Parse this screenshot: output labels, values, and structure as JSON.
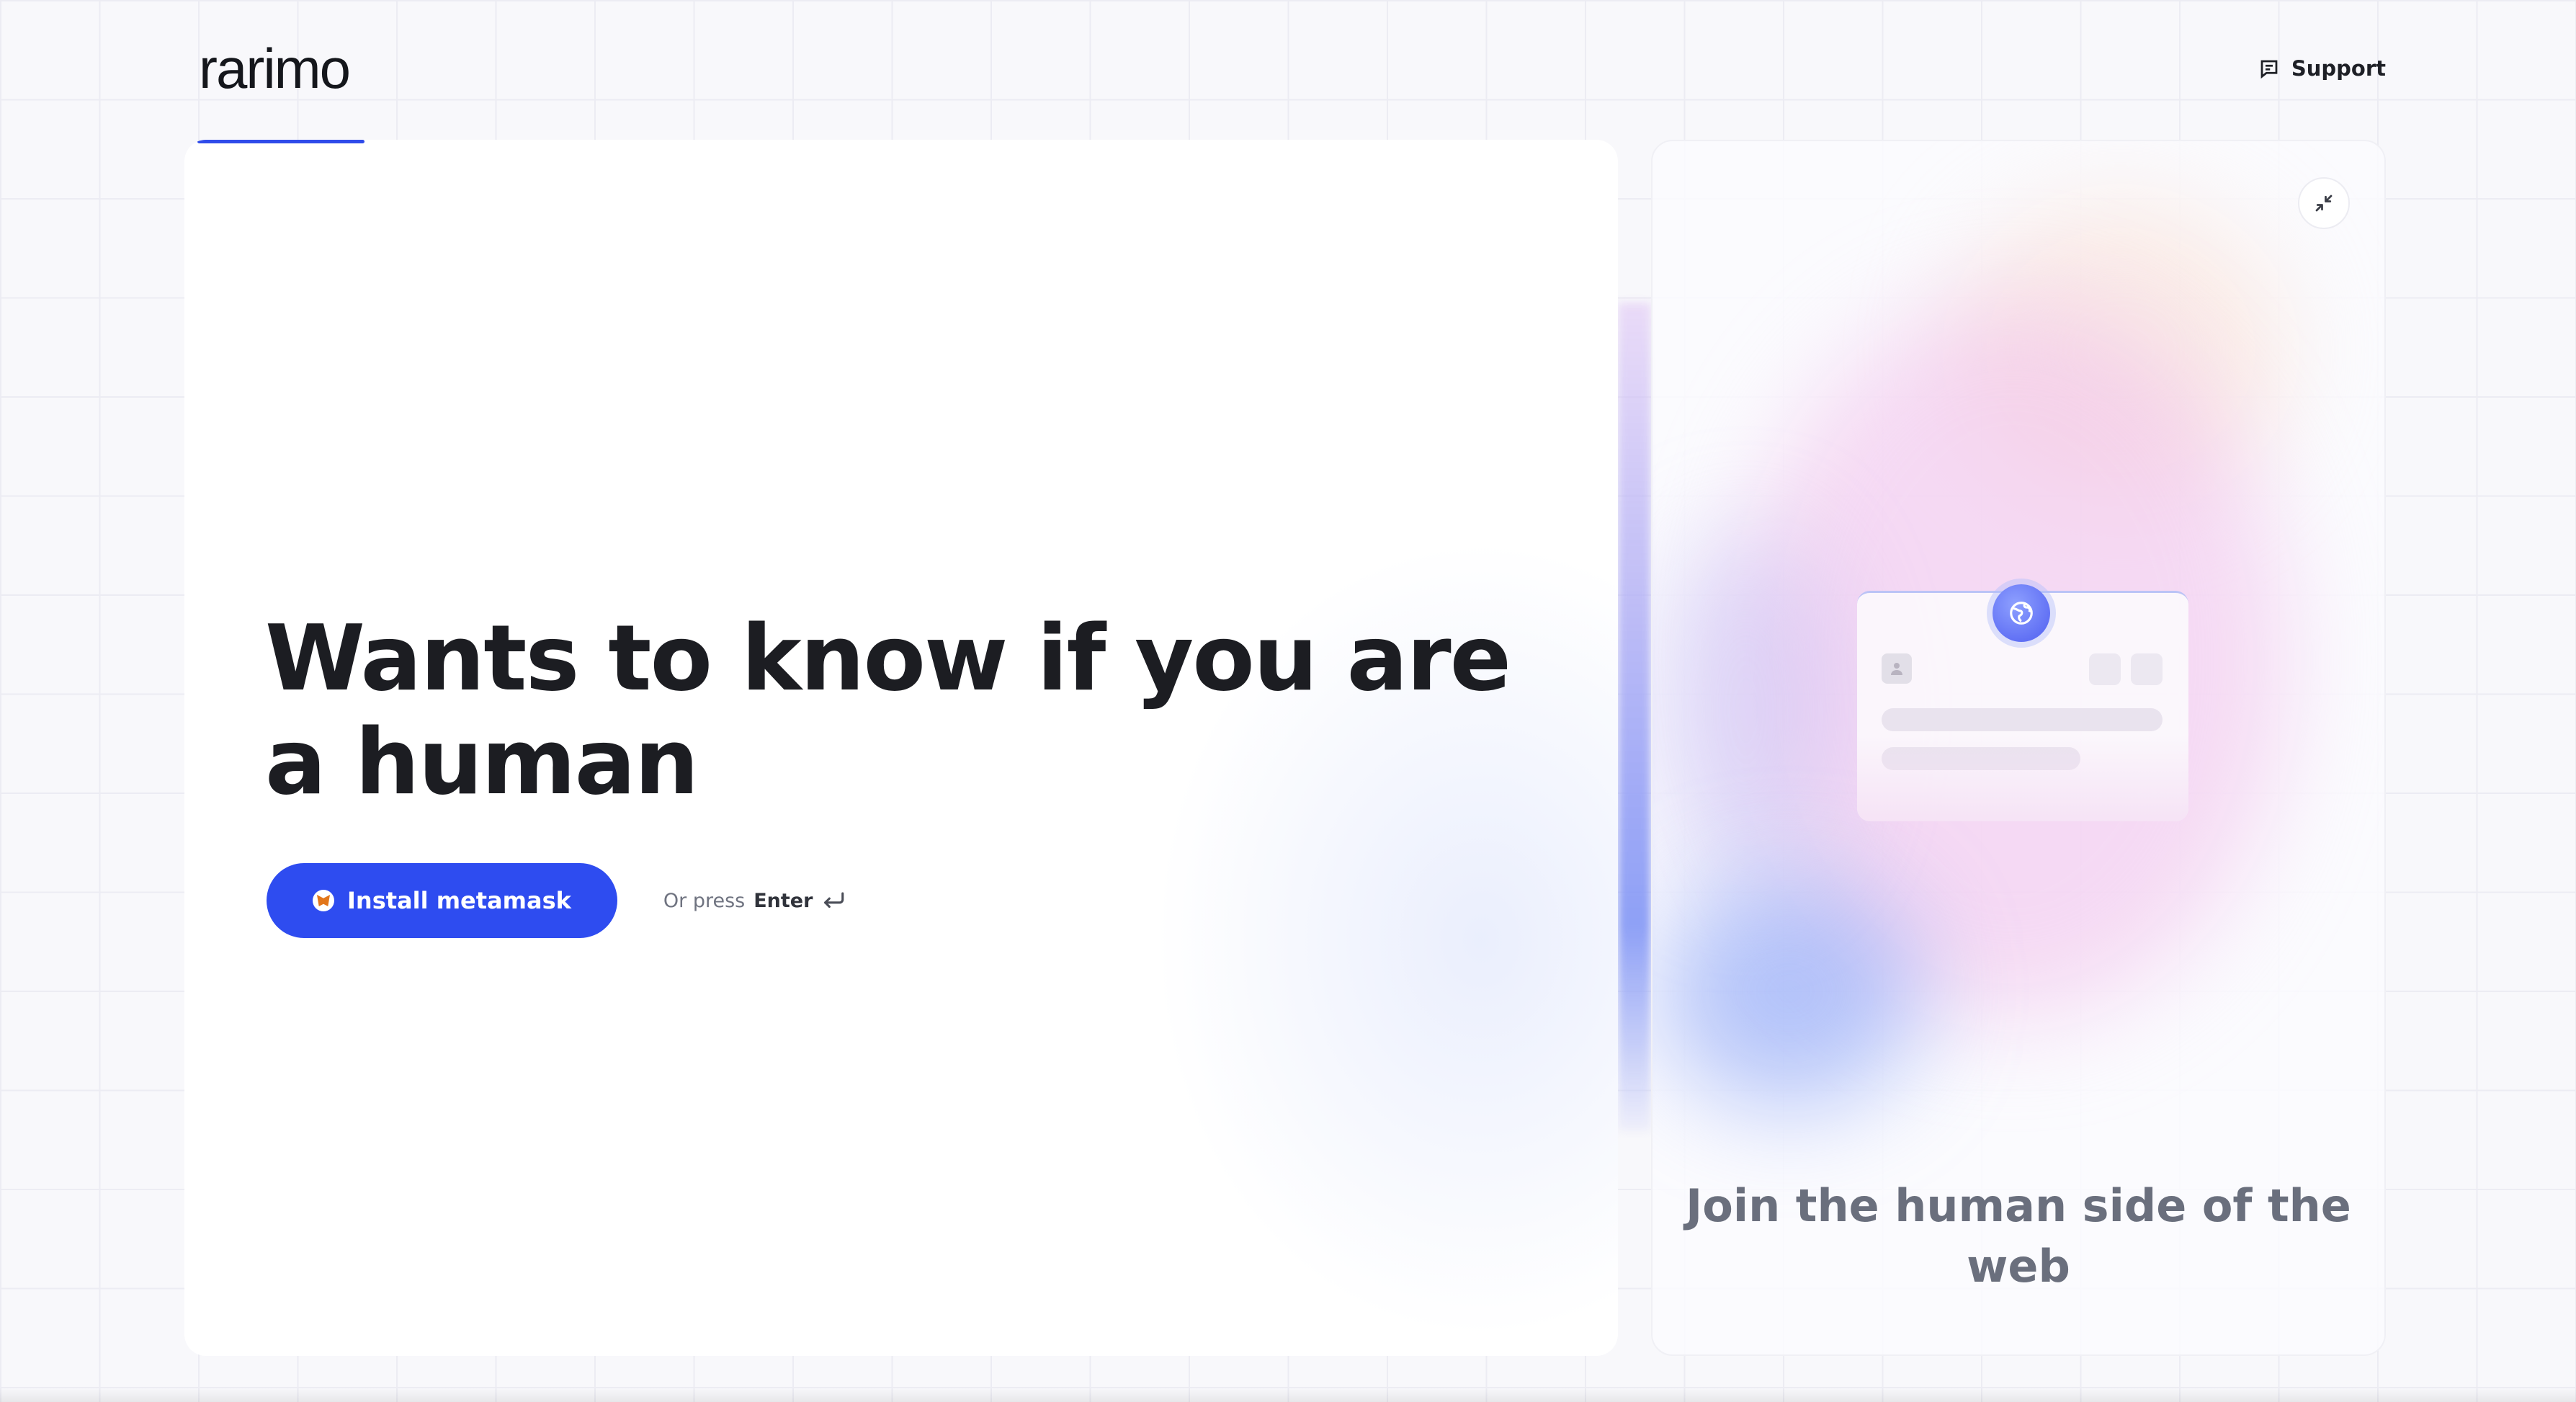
{
  "header": {
    "logo_text": "rarimo",
    "support_label": "Support",
    "support_icon": "chat-bubble-icon"
  },
  "main": {
    "headline": "Wants to know if you are a human",
    "install_button_label": "Install metamask",
    "install_button_icon": "metamask-fox-icon",
    "press_hint_prefix": "Or press",
    "press_hint_key": "Enter",
    "press_hint_icon": "enter-return-icon"
  },
  "side_panel": {
    "collapse_icon": "collapse-arrows-icon",
    "badge_icon": "globe-icon",
    "avatar_icon": "user-icon",
    "caption": "Join the human side of the web"
  },
  "colors": {
    "accent": "#2e4cf0",
    "headline": "#1c1d22",
    "caption": "#6a6f7d"
  }
}
